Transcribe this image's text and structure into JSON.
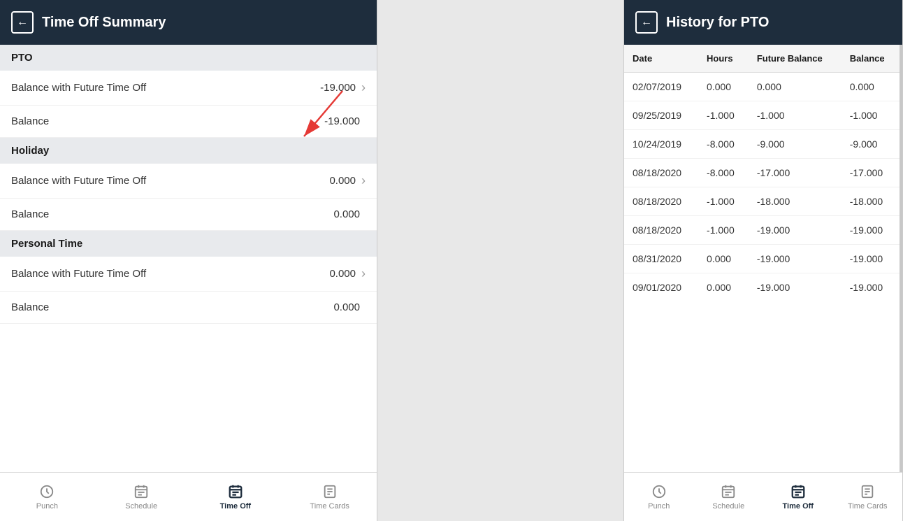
{
  "leftPanel": {
    "header": {
      "backLabel": "←",
      "title": "Time Off Summary"
    },
    "sections": [
      {
        "id": "pto",
        "label": "PTO",
        "rows": [
          {
            "label": "Balance with Future Time Off",
            "value": "-19.000",
            "hasChevron": true
          },
          {
            "label": "Balance",
            "value": "-19.000",
            "hasChevron": false
          }
        ]
      },
      {
        "id": "holiday",
        "label": "Holiday",
        "rows": [
          {
            "label": "Balance with Future Time Off",
            "value": "0.000",
            "hasChevron": true
          },
          {
            "label": "Balance",
            "value": "0.000",
            "hasChevron": false
          }
        ]
      },
      {
        "id": "personal-time",
        "label": "Personal Time",
        "rows": [
          {
            "label": "Balance with Future Time Off",
            "value": "0.000",
            "hasChevron": true
          },
          {
            "label": "Balance",
            "value": "0.000",
            "hasChevron": false
          }
        ]
      }
    ],
    "nav": [
      {
        "id": "punch",
        "label": "Punch",
        "active": false
      },
      {
        "id": "schedule",
        "label": "Schedule",
        "active": false
      },
      {
        "id": "time-off",
        "label": "Time Off",
        "active": true
      },
      {
        "id": "time-cards",
        "label": "Time Cards",
        "active": false
      }
    ]
  },
  "rightPanel": {
    "header": {
      "backLabel": "←",
      "title": "History for PTO"
    },
    "table": {
      "columns": [
        "Date",
        "Hours",
        "Future Balance",
        "Balance"
      ],
      "rows": [
        {
          "date": "02/07/2019",
          "hours": "0.000",
          "futureBalance": "0.000",
          "balance": "0.000"
        },
        {
          "date": "09/25/2019",
          "hours": "-1.000",
          "futureBalance": "-1.000",
          "balance": "-1.000"
        },
        {
          "date": "10/24/2019",
          "hours": "-8.000",
          "futureBalance": "-9.000",
          "balance": "-9.000"
        },
        {
          "date": "08/18/2020",
          "hours": "-8.000",
          "futureBalance": "-17.000",
          "balance": "-17.000"
        },
        {
          "date": "08/18/2020",
          "hours": "-1.000",
          "futureBalance": "-18.000",
          "balance": "-18.000"
        },
        {
          "date": "08/18/2020",
          "hours": "-1.000",
          "futureBalance": "-19.000",
          "balance": "-19.000"
        },
        {
          "date": "08/31/2020",
          "hours": "0.000",
          "futureBalance": "-19.000",
          "balance": "-19.000"
        },
        {
          "date": "09/01/2020",
          "hours": "0.000",
          "futureBalance": "-19.000",
          "balance": "-19.000"
        }
      ]
    },
    "nav": [
      {
        "id": "punch",
        "label": "Punch",
        "active": false
      },
      {
        "id": "schedule",
        "label": "Schedule",
        "active": false
      },
      {
        "id": "time-off",
        "label": "Time Off",
        "active": true
      },
      {
        "id": "time-cards",
        "label": "Time Cards",
        "active": false
      }
    ]
  }
}
